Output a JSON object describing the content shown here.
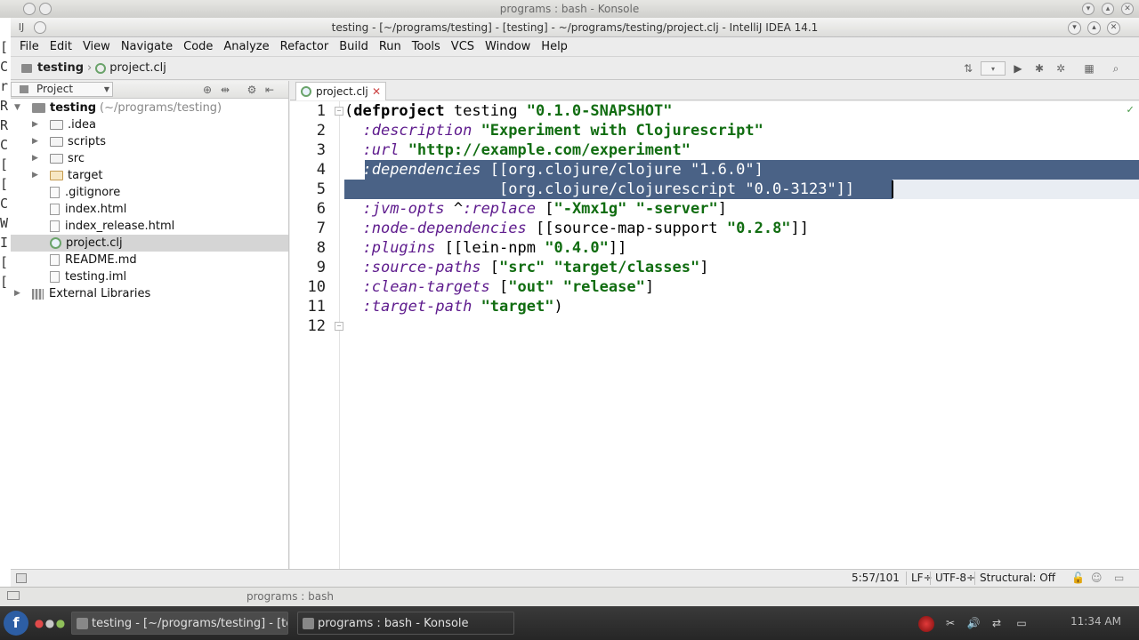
{
  "konsole": {
    "title": "programs : bash - Konsole",
    "bg_chars": [
      "[",
      "C",
      "r",
      "R",
      "R",
      "C",
      "[",
      "[",
      "C",
      "W",
      "I",
      "[",
      "["
    ],
    "bottom_label": "programs : bash"
  },
  "ide": {
    "title": "testing - [~/programs/testing] - [testing] - ~/programs/testing/project.clj - IntelliJ IDEA 14.1",
    "menu": [
      "File",
      "Edit",
      "View",
      "Navigate",
      "Code",
      "Analyze",
      "Refactor",
      "Build",
      "Run",
      "Tools",
      "VCS",
      "Window",
      "Help"
    ],
    "breadcrumb": {
      "project": "testing",
      "file": "project.clj"
    },
    "project_panel": {
      "view_label": "Project",
      "root": {
        "name": "testing",
        "path": "(~/programs/testing)"
      },
      "items": [
        {
          "label": ".idea",
          "kind": "folder"
        },
        {
          "label": "scripts",
          "kind": "folder"
        },
        {
          "label": "src",
          "kind": "folder"
        },
        {
          "label": "target",
          "kind": "folder"
        },
        {
          "label": ".gitignore",
          "kind": "file"
        },
        {
          "label": "index.html",
          "kind": "file"
        },
        {
          "label": "index_release.html",
          "kind": "file"
        },
        {
          "label": "project.clj",
          "kind": "clj",
          "selected": true
        },
        {
          "label": "README.md",
          "kind": "file"
        },
        {
          "label": "testing.iml",
          "kind": "file"
        }
      ],
      "external": "External Libraries"
    },
    "editor": {
      "tab_label": "project.clj",
      "line_numbers": [
        "1",
        "2",
        "3",
        "4",
        "5",
        "6",
        "7",
        "8",
        "9",
        "10",
        "11",
        "12"
      ],
      "lines": {
        "l1_open": "(",
        "l1_kw": "defproject",
        "l1_name": " testing ",
        "l1_ver": "\"0.1.0-SNAPSHOT\"",
        "l2_key": ":description",
        "l2_str": "\"Experiment with Clojurescript\"",
        "l3_key": ":url",
        "l3_str": "\"http://example.com/experiment\"",
        "l4_key": ":dependencies",
        "l4_rest": " [[org.clojure/clojure \"1.6.0\"]",
        "l5_text": "               [org.clojure/clojurescript \"0.0-3123\"]]",
        "l6_key": ":jvm-opts",
        "l6_meta": " ^",
        "l6_key2": ":replace",
        "l6_open": " [",
        "l6_s1": "\"-Xmx1g\"",
        "l6_s2": "\"-server\"",
        "l6_close": "]",
        "l7_key": ":node-dependencies",
        "l7_mid": " [[source-map-support ",
        "l7_str": "\"0.2.8\"",
        "l7_close": "]]",
        "l8_key": ":plugins",
        "l8_mid": " [[lein-npm ",
        "l8_str": "\"0.4.0\"",
        "l8_close": "]]",
        "l9_key": ":source-paths",
        "l9_open": " [",
        "l9_s1": "\"src\"",
        "l9_s2": "\"target/classes\"",
        "l9_close": "]",
        "l10_key": ":clean-targets",
        "l10_open": " [",
        "l10_s1": "\"out\"",
        "l10_s2": "\"release\"",
        "l10_close": "]",
        "l11_key": ":target-path",
        "l11_str": "\"target\"",
        "l11_close": ")"
      }
    },
    "status": {
      "position": "5:57/101",
      "line_sep": "LF÷",
      "encoding": "UTF-8÷",
      "structural": "Structural: Off"
    }
  },
  "taskbar": {
    "tasks": [
      {
        "label": "testing - [~/programs/testing] - [te",
        "active": true
      },
      {
        "label": "programs : bash - Konsole",
        "active": false
      }
    ],
    "clock": "11:34 AM"
  },
  "colors": {
    "selection": "#4a6286",
    "keyword_purple": "#5e1b8d",
    "string_green": "#116d11"
  }
}
